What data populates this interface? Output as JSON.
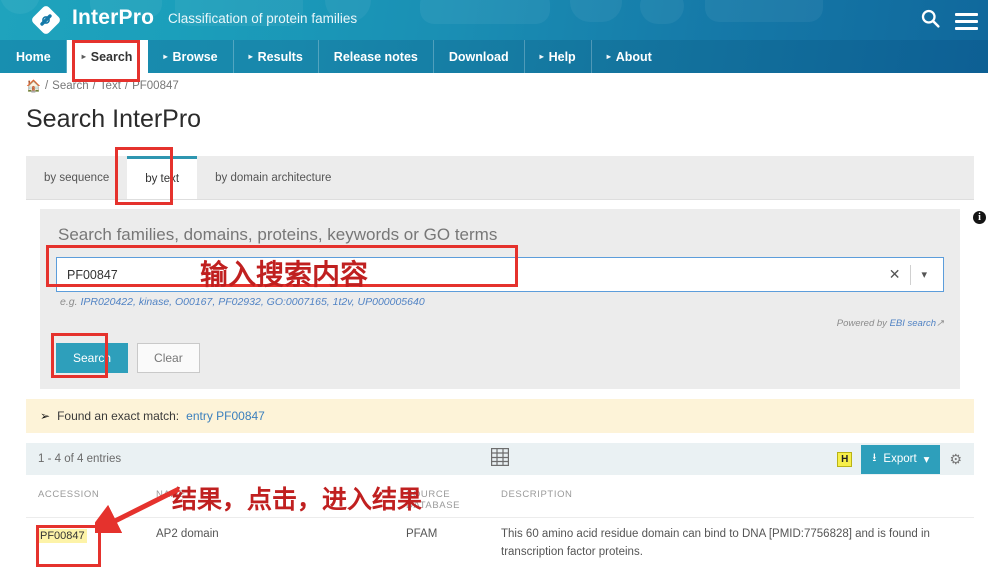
{
  "header": {
    "brand": "InterPro",
    "tagline": "Classification of protein families",
    "search_icon": "search-icon",
    "menu_icon": "hamburger-menu-icon",
    "logo_icon": "interpro-diamond-logo"
  },
  "nav": {
    "items": [
      {
        "label": "Home",
        "caret": false,
        "active": false
      },
      {
        "label": "Search",
        "caret": true,
        "active": true
      },
      {
        "label": "Browse",
        "caret": true,
        "active": false
      },
      {
        "label": "Results",
        "caret": true,
        "active": false
      },
      {
        "label": "Release notes",
        "caret": false,
        "active": false
      },
      {
        "label": "Download",
        "caret": false,
        "active": false
      },
      {
        "label": "Help",
        "caret": true,
        "active": false
      },
      {
        "label": "About",
        "caret": true,
        "active": false
      }
    ]
  },
  "breadcrumb": {
    "home_icon": "home-icon",
    "items": [
      "Search",
      "Text",
      "PF00847"
    ],
    "separator": "/"
  },
  "page": {
    "title": "Search InterPro"
  },
  "tabs": [
    {
      "label": "by sequence",
      "active": false
    },
    {
      "label": "by text",
      "active": true
    },
    {
      "label": "by domain architecture",
      "active": false
    }
  ],
  "search": {
    "heading": "Search families, domains, proteins, keywords or GO terms",
    "value": "PF00847",
    "placeholder": "Search families, domains, proteins, keywords or GO terms",
    "clear_icon": "clear-x-icon",
    "dropdown_icon": "chevron-down-icon",
    "info_icon": "info-icon",
    "info_glyph": "i",
    "hint_prefix": "e.g. ",
    "hint_examples": "IPR020422, kinase, O00167, PF02932, GO:0007165, 1t2v, UP000005640",
    "powered_prefix": "Powered by ",
    "powered_link": "EBI search",
    "external_link_icon": "external-link-icon",
    "search_button": "Search",
    "clear_button": "Clear"
  },
  "alert": {
    "icon": "arrow-circle-right-icon",
    "text": "Found an exact match:",
    "link": "entry PF00847"
  },
  "results_bar": {
    "count_text": "1 - 4 of 4 entries",
    "grid_icon": "grid-view-icon",
    "highlight_badge": "H",
    "export_label": "Export",
    "export_icon": "download-icon",
    "export_caret_icon": "caret-down-icon",
    "settings_icon": "gear-icon"
  },
  "table": {
    "columns": [
      "ACCESSION",
      "NAME",
      "SOURCE DATABASE",
      "DESCRIPTION"
    ],
    "source_db_line1": "SOURCE",
    "source_db_line2": "DATABASE",
    "rows": [
      {
        "accession": "PF00847",
        "name": "AP2 domain",
        "database": "PFAM",
        "description": "This 60 amino acid residue domain can bind to DNA [PMID:7756828] and is found in transcription factor proteins."
      }
    ]
  },
  "annotations": {
    "input_label": "输入搜索内容",
    "result_label": "结果，点击，进入结果",
    "box_color": "#e5322d",
    "text_color": "#c02020"
  },
  "colors": {
    "brand_teal": "#2e9fbb",
    "header_gradient_start": "#1fa3bd",
    "header_gradient_end": "#10689c",
    "alert_bg": "#fdf3d8",
    "highlight_yellow": "#fdf3a8",
    "badge_yellow": "#f7ef4a",
    "link_blue": "#3a7fbd"
  }
}
